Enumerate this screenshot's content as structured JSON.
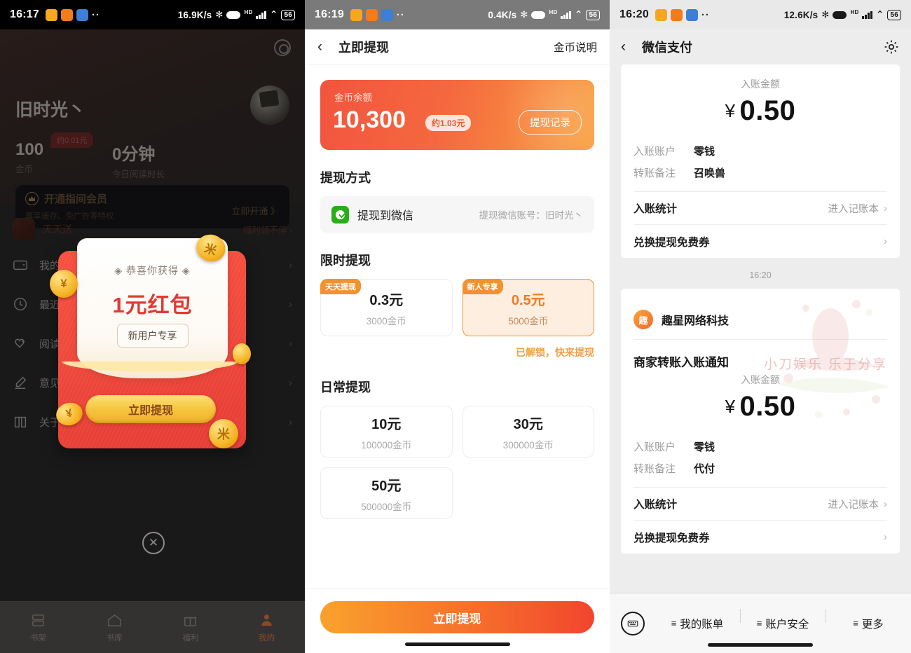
{
  "panel1": {
    "statusbar": {
      "time": "16:17",
      "speed": "16.9K/s",
      "battery": "56",
      "dots": "··"
    },
    "profile": {
      "name": "旧时光丶",
      "badge": "约0.01元",
      "stats": [
        {
          "value": "100",
          "label": "金币"
        },
        {
          "value": "0分钟",
          "label": "今日阅读时长"
        }
      ]
    },
    "vip": {
      "title": "开通指间会员",
      "subtitle": "尊享缓存、免广告等特权",
      "cta": "立即开通 》"
    },
    "banner": {
      "left": "天天送",
      "right": "福利领不停 ›"
    },
    "menu": [
      {
        "label": "我的钱包",
        "icon": "wallet-icon"
      },
      {
        "label": "最近阅读",
        "icon": "clock-icon"
      },
      {
        "label": "阅读偏好",
        "icon": "heart-tag-icon"
      },
      {
        "label": "意见反馈",
        "icon": "pencil-icon"
      },
      {
        "label": "关于我们",
        "icon": "book-icon"
      }
    ],
    "dialog": {
      "congrats": "◈ 恭喜你获得 ◈",
      "amount": "1元红包",
      "tag": "新用户专享",
      "button": "立即提现",
      "coin_symbol": "¥",
      "coin_symbol_alt": "米",
      "close": "✕"
    },
    "bottomnav": [
      {
        "label": "书架",
        "icon": "shelf-icon",
        "active": false
      },
      {
        "label": "书库",
        "icon": "home-icon",
        "active": false
      },
      {
        "label": "福利",
        "icon": "gift-icon",
        "active": false
      },
      {
        "label": "我的",
        "icon": "user-icon",
        "active": true
      }
    ]
  },
  "panel2": {
    "statusbar": {
      "time": "16:19",
      "speed": "0.4K/s",
      "battery": "56",
      "dots": "··"
    },
    "nav": {
      "back": "‹",
      "title": "立即提现",
      "action": "金币说明"
    },
    "balance": {
      "label": "金币余额",
      "amount": "10,300",
      "approx": "约1.03元",
      "record_button": "提现记录"
    },
    "method_section_title": "提现方式",
    "method": {
      "name": "提现到微信",
      "account": "提现微信账号：旧时光丶",
      "icon": "wechat-icon"
    },
    "limited_section_title": "限时提现",
    "limited_options": [
      {
        "badge": "天天提现",
        "amount": "0.3元",
        "coins": "3000金币",
        "selected": false
      },
      {
        "badge": "新人专享",
        "amount": "0.5元",
        "coins": "5000金币",
        "selected": true
      }
    ],
    "unlocked_hint": "已解锁，快来提现",
    "daily_section_title": "日常提现",
    "daily_options": [
      {
        "amount": "10元",
        "coins": "100000金币"
      },
      {
        "amount": "30元",
        "coins": "300000金币"
      },
      {
        "amount": "50元",
        "coins": "500000金币"
      }
    ],
    "cta": "立即提现"
  },
  "panel3": {
    "statusbar": {
      "time": "16:20",
      "speed": "12.6K/s",
      "battery": "56",
      "dots": "··"
    },
    "nav": {
      "back": "‹",
      "title": "微信支付",
      "gear": "gear-icon"
    },
    "message1": {
      "amount_label": "入账金额",
      "yen": "¥",
      "amount": "0.50",
      "fields": [
        {
          "key": "入账账户",
          "value": "零钱"
        },
        {
          "key": "转账备注",
          "value": "召唤兽"
        }
      ],
      "rows": [
        {
          "label": "入账统计",
          "right": "进入记账本",
          "chev": "›"
        },
        {
          "label": "兑换提现免费券",
          "right": "",
          "chev": "›"
        }
      ]
    },
    "timestamp": "16:20",
    "message2": {
      "merchant": "趣星网络科技",
      "merchant_logo": "趣",
      "notification_title": "商家转账入账通知",
      "amount_label": "入账金额",
      "yen": "¥",
      "amount": "0.50",
      "fields": [
        {
          "key": "入账账户",
          "value": "零钱"
        },
        {
          "key": "转账备注",
          "value": "代付"
        }
      ],
      "rows": [
        {
          "label": "入账统计",
          "right": "进入记账本",
          "chev": "›"
        },
        {
          "label": "兑换提现免费券",
          "right": "",
          "chev": "›"
        }
      ]
    },
    "watermark": "小刀娱乐 乐于分享",
    "toolbar": {
      "keyboard_icon": "keyboard-icon",
      "items": [
        {
          "label": "我的账单",
          "icon": "hamburger-icon"
        },
        {
          "label": "账户安全",
          "icon": "hamburger-icon"
        },
        {
          "label": "更多",
          "icon": "hamburger-icon"
        }
      ]
    }
  },
  "colors": {
    "orange_primary": "#f2692c",
    "red_packet": "#e63c34",
    "wechat_green": "#2aad19",
    "gold": "#f5b11e"
  }
}
